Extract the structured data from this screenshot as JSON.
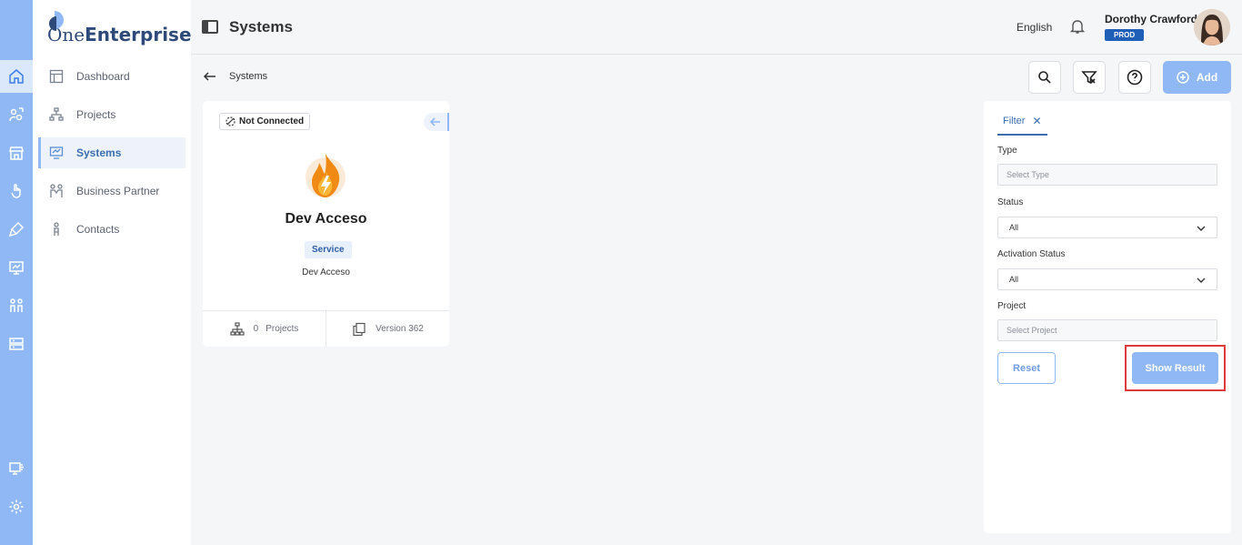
{
  "app": {
    "logo_prefix": "One",
    "logo_suffix": "Enterprise"
  },
  "sidebar": {
    "items": [
      {
        "label": "Dashboard",
        "icon": "dashboard-icon"
      },
      {
        "label": "Projects",
        "icon": "projects-icon"
      },
      {
        "label": "Systems",
        "icon": "systems-icon",
        "active": true
      },
      {
        "label": "Business Partner",
        "icon": "business-partner-icon"
      },
      {
        "label": "Contacts",
        "icon": "contacts-icon"
      }
    ]
  },
  "rail": {
    "icons": [
      "home-icon",
      "users-switch-icon",
      "store-icon",
      "touch-icon",
      "brush-icon",
      "monitor-chart-icon",
      "team-icon",
      "server-icon",
      "remote-icon",
      "settings-icon"
    ]
  },
  "header": {
    "title": "Systems",
    "language": "English",
    "user_name": "Dorothy Crawford",
    "environment": "PROD"
  },
  "subheader": {
    "breadcrumb": "Systems",
    "add_label": "Add"
  },
  "card": {
    "status": "Not Connected",
    "title": "Dev Acceso",
    "type": "Service",
    "subtitle": "Dev Acceso",
    "projects_count": "0",
    "projects_label": "Projects",
    "version": "Version 362"
  },
  "filter": {
    "tab_label": "Filter",
    "type_label": "Type",
    "type_placeholder": "Select Type",
    "status_label": "Status",
    "status_value": "All",
    "activation_label": "Activation Status",
    "activation_value": "All",
    "project_label": "Project",
    "project_placeholder": "Select Project",
    "reset_label": "Reset",
    "show_label": "Show Result"
  },
  "colors": {
    "accent": "#8fb8f5",
    "brand": "#2d4a7a",
    "env_badge": "#1f5fb8",
    "highlight": "#e03b3b"
  }
}
